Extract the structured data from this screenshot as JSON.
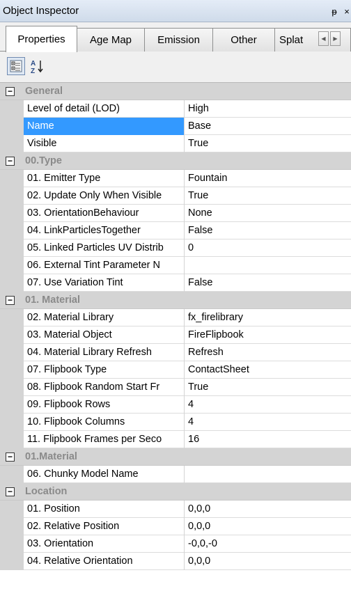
{
  "window": {
    "title": "Object Inspector",
    "pin_glyph": "ᵽ",
    "close_glyph": "×"
  },
  "tabs": [
    {
      "label": "Properties",
      "active": true
    },
    {
      "label": "Age Map"
    },
    {
      "label": "Emission"
    },
    {
      "label": "Other"
    },
    {
      "label": "Splat"
    }
  ],
  "toolbar": {
    "categorized_icon": "categorized-view-icon",
    "alpha_icon": "alphabetical-sort-icon",
    "alpha_glyph_top": "A",
    "alpha_glyph_bottom": "Z"
  },
  "selected_color": "#3399ff",
  "grid": {
    "groups": [
      {
        "category": "General",
        "rows": [
          {
            "name": "Level of detail (LOD)",
            "value": "High"
          },
          {
            "name": "Name",
            "value": "Base",
            "selected": true
          },
          {
            "name": "Visible",
            "value": "True"
          }
        ]
      },
      {
        "category": "00.Type",
        "rows": [
          {
            "name": "01. Emitter Type",
            "value": "Fountain"
          },
          {
            "name": "02. Update Only When Visible",
            "value": "True"
          },
          {
            "name": "03. OrientationBehaviour",
            "value": "None"
          },
          {
            "name": "04. LinkParticlesTogether",
            "value": "False"
          },
          {
            "name": "05. Linked Particles UV Distrib",
            "value": "0"
          },
          {
            "name": "06. External Tint Parameter N",
            "value": ""
          },
          {
            "name": "07. Use Variation Tint",
            "value": "False"
          }
        ]
      },
      {
        "category": "01. Material",
        "rows": [
          {
            "name": "02. Material Library",
            "value": "fx_firelibrary"
          },
          {
            "name": "03. Material Object",
            "value": "FireFlipbook"
          },
          {
            "name": "04. Material Library Refresh",
            "value": "Refresh"
          },
          {
            "name": "07. Flipbook Type",
            "value": "ContactSheet"
          },
          {
            "name": "08. Flipbook Random Start Fr",
            "value": "True"
          },
          {
            "name": "09. Flipbook Rows",
            "value": "4"
          },
          {
            "name": "10. Flipbook Columns",
            "value": "4"
          },
          {
            "name": "11. Flipbook Frames per Seco",
            "value": "16"
          }
        ]
      },
      {
        "category": "01.Material",
        "rows": [
          {
            "name": "06. Chunky Model Name",
            "value": ""
          }
        ]
      },
      {
        "category": "Location",
        "rows": [
          {
            "name": "01. Position",
            "value": "0,0,0"
          },
          {
            "name": "02. Relative Position",
            "value": "0,0,0"
          },
          {
            "name": "03. Orientation",
            "value": "-0,0,-0"
          },
          {
            "name": "04. Relative Orientation",
            "value": "0,0,0"
          }
        ]
      }
    ]
  }
}
